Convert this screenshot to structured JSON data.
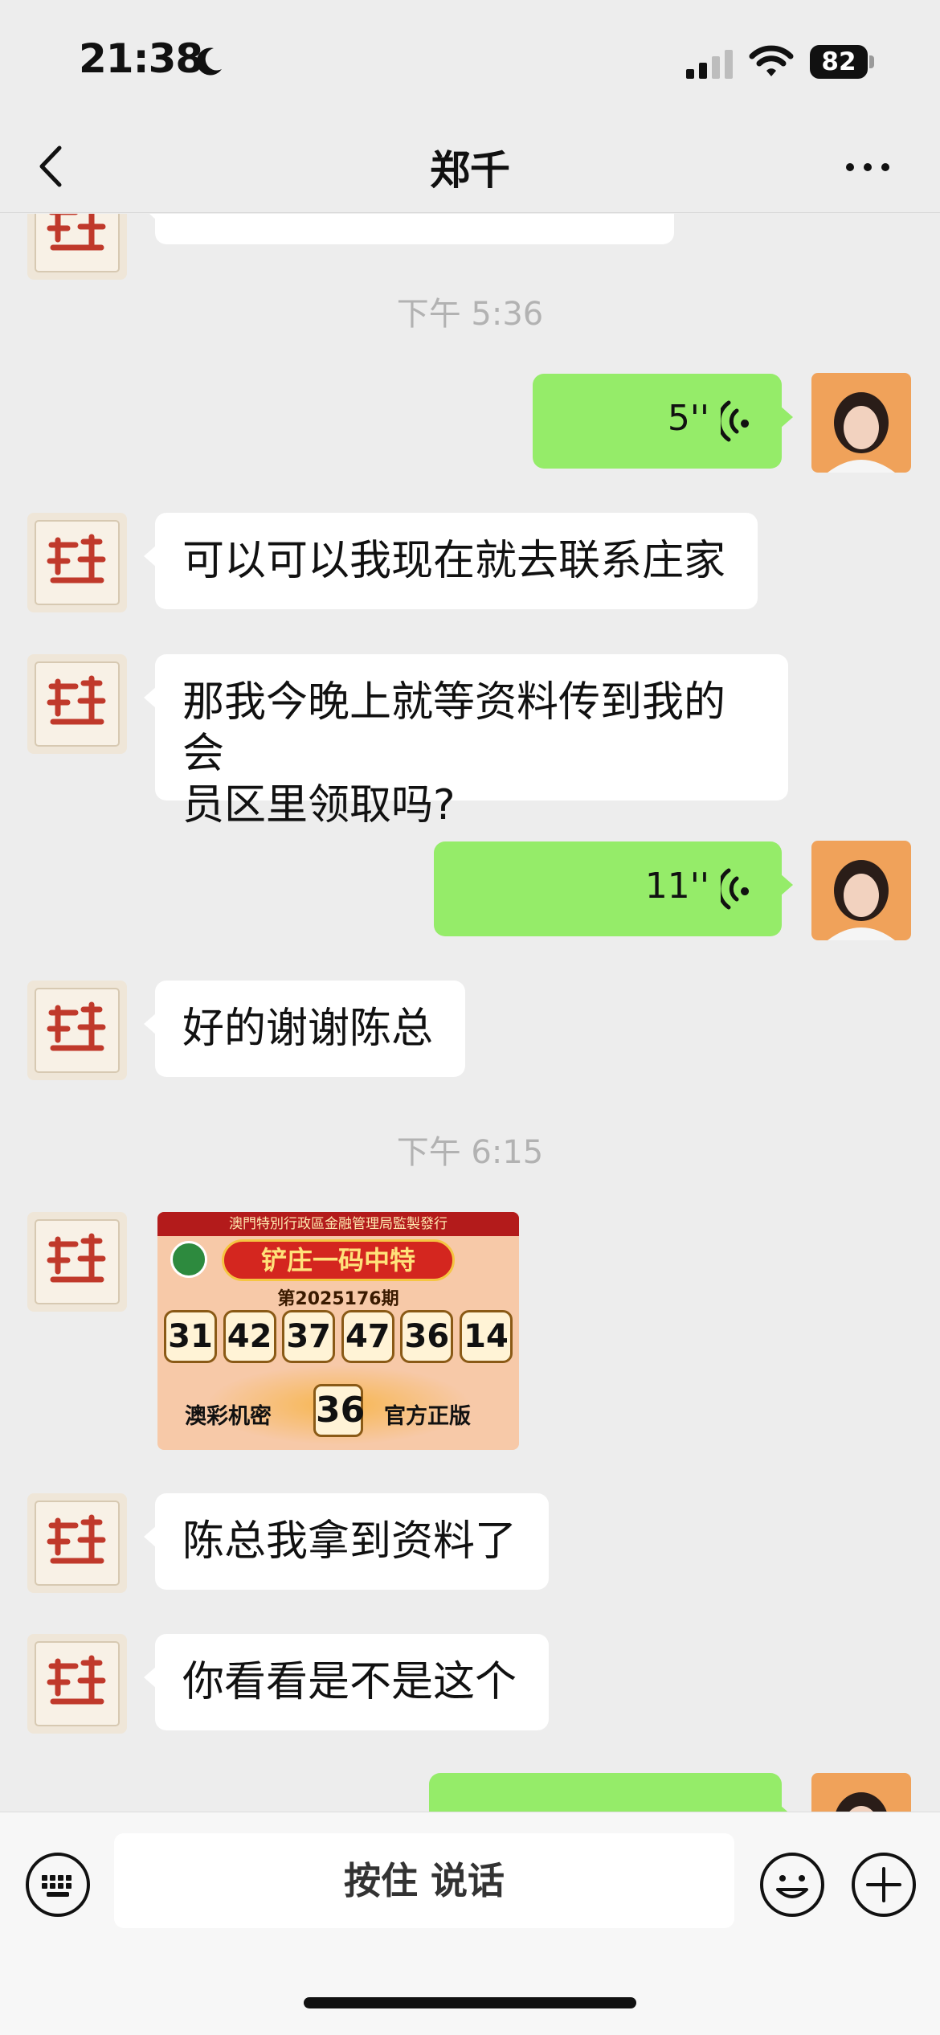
{
  "status_bar": {
    "time": "21:38",
    "battery": "82",
    "icons": [
      "moon-icon",
      "signal-icon",
      "wifi-icon",
      "battery-icon"
    ]
  },
  "nav": {
    "title": "郑千",
    "back_icon": "chevron-left-icon",
    "more_icon": "more-dots-icon"
  },
  "messages": {
    "ts1": "下午 5:36",
    "voice1_duration": "5''",
    "msg1": "可以可以我现在就去联系庄家",
    "msg2_line1": "那我今晚上就等资料传到我的会",
    "msg2_line2": "员区里领取吗?",
    "voice2_duration": "11''",
    "msg3": "好的谢谢陈总",
    "ts2": "下午 6:15",
    "msg4": "陈总我拿到资料了",
    "msg5": "你看看是不是这个"
  },
  "lottery_image": {
    "header": "澳門特別行政區金融管理局監製發行",
    "title": "铲庄一码中特",
    "period": "第2025176期",
    "numbers": [
      "31",
      "42",
      "37",
      "47",
      "36",
      "14"
    ],
    "foot_left": "澳彩机密",
    "special": "36",
    "foot_right": "官方正版"
  },
  "input_bar": {
    "hold_to_talk": "按住 说话",
    "icons": [
      "keyboard-icon",
      "emoji-icon",
      "plus-icon"
    ]
  },
  "colors": {
    "background": "#ededed",
    "outgoing_bubble": "#95ec69",
    "incoming_bubble": "#ffffff",
    "timestamp": "#b2b2b2"
  }
}
